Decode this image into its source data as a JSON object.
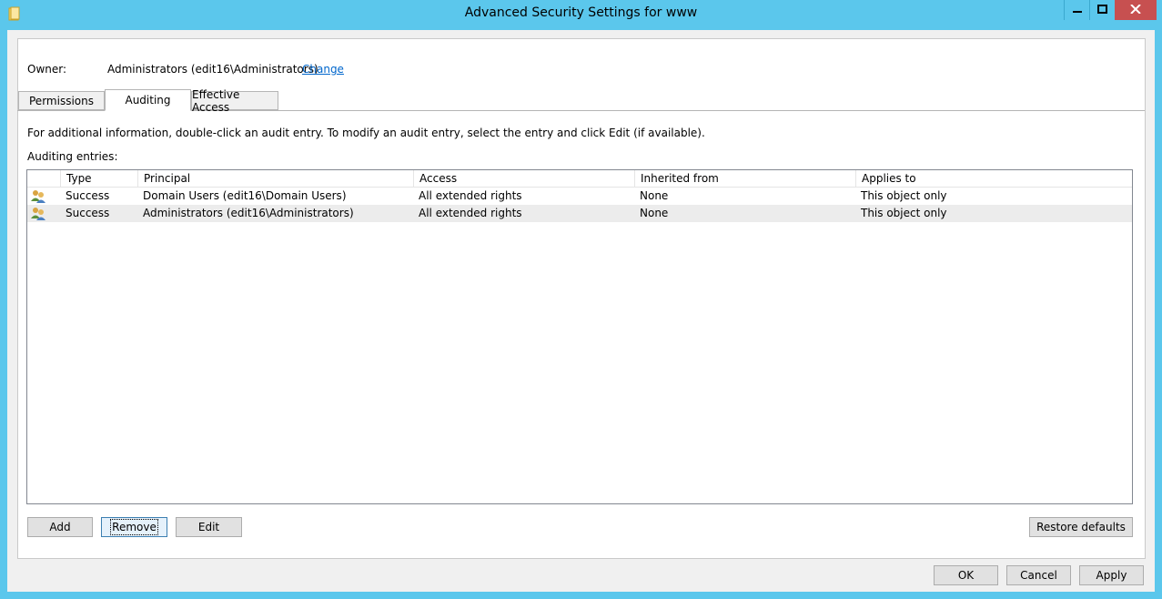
{
  "window": {
    "title": "Advanced Security Settings for www"
  },
  "owner": {
    "label": "Owner:",
    "value": "Administrators (edit16\\Administrators)",
    "change_link": "Change"
  },
  "tabs": [
    {
      "label": "Permissions",
      "active": false
    },
    {
      "label": "Auditing",
      "active": true
    },
    {
      "label": "Effective Access",
      "active": false
    }
  ],
  "info_text": "For additional information, double-click an audit entry. To modify an audit entry, select the entry and click Edit (if available).",
  "entries_label": "Auditing entries:",
  "table": {
    "columns": [
      "Type",
      "Principal",
      "Access",
      "Inherited from",
      "Applies to"
    ],
    "rows": [
      {
        "icon": "user-group-icon",
        "type": "Success",
        "principal": "Domain Users (edit16\\Domain Users)",
        "access": "All extended rights",
        "inherited_from": "None",
        "applies_to": "This object only"
      },
      {
        "icon": "user-group-icon",
        "type": "Success",
        "principal": "Administrators (edit16\\Administrators)",
        "access": "All extended rights",
        "inherited_from": "None",
        "applies_to": "This object only"
      }
    ]
  },
  "buttons": {
    "add": "Add",
    "remove": "Remove",
    "edit": "Edit",
    "restore_defaults": "Restore defaults",
    "ok": "OK",
    "cancel": "Cancel",
    "apply": "Apply"
  },
  "colors": {
    "titlebar": "#5bc7ec",
    "close_button": "#c75050",
    "link": "#0066cc"
  }
}
